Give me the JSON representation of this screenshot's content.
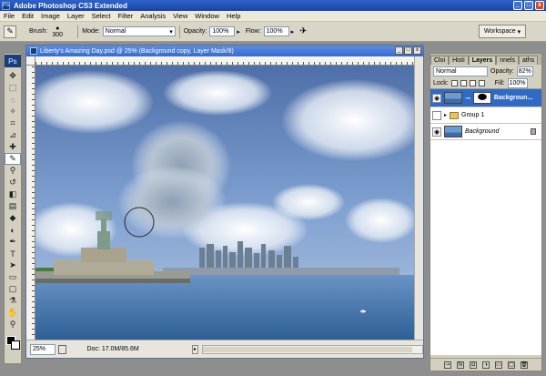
{
  "app": {
    "title": "Adobe Photoshop CS3 Extended",
    "logo": "Ps",
    "window_buttons": [
      "_",
      "□",
      "x"
    ]
  },
  "menu": [
    "File",
    "Edit",
    "Image",
    "Layer",
    "Select",
    "Filter",
    "Analysis",
    "View",
    "Window",
    "Help"
  ],
  "options": {
    "brush_label": "Brush:",
    "brush_size": "300",
    "mode_label": "Mode:",
    "mode_value": "Normal",
    "opacity_label": "Opacity:",
    "opacity_value": "100%",
    "flow_label": "Flow:",
    "flow_value": "100%",
    "workspace_label": "Workspace"
  },
  "toolbox": {
    "tools": [
      "move-icon",
      "marquee-icon",
      "lasso-icon",
      "magic-wand-icon",
      "crop-icon",
      "eyedropper-icon",
      "healing-icon",
      "brush-icon",
      "clone-stamp-icon",
      "history-brush-icon",
      "eraser-icon",
      "gradient-icon",
      "blur-icon",
      "dodge-icon",
      "pen-icon",
      "type-icon",
      "path-select-icon",
      "shape-icon",
      "notes-icon",
      "eyedropper2-icon",
      "hand-icon",
      "zoom-icon"
    ],
    "active_tool_index": 7
  },
  "document": {
    "title": "Liberty's Amazing Day.psd @ 25% (Background copy, Layer Mask/8)",
    "zoom": "25%",
    "doc_info": "Doc: 17.0M/85.6M",
    "buttons": [
      "_",
      "□",
      "x"
    ]
  },
  "layers_panel": {
    "tabs": [
      "Cloi",
      "Histi",
      "Layers",
      "nnels",
      "aths"
    ],
    "active_tab_index": 2,
    "blend_mode": "Normal",
    "opacity_label": "Opacity:",
    "opacity_value": "82%",
    "lock_label": "Lock:",
    "fill_label": "Fill:",
    "fill_value": "100%",
    "layers": [
      {
        "name": "Backgroun...",
        "visible": true,
        "selected": true,
        "type": "masked"
      },
      {
        "name": "Group 1",
        "visible": false,
        "selected": false,
        "type": "group"
      },
      {
        "name": "Background",
        "visible": true,
        "selected": false,
        "type": "background"
      }
    ],
    "bottom_icons": [
      "link-icon",
      "fx-icon",
      "mask-icon",
      "adjustment-icon",
      "folder-icon",
      "new-layer-icon",
      "trash-icon"
    ],
    "bottom_labels": [
      "⊸",
      "fx",
      "◘",
      "◑",
      "▭",
      "▢",
      "🗑"
    ]
  },
  "colors": {
    "titlebar": "#1745a6",
    "selected_layer": "#316ac5",
    "sky": "#6f92c4",
    "water": "#3b6fa6"
  }
}
